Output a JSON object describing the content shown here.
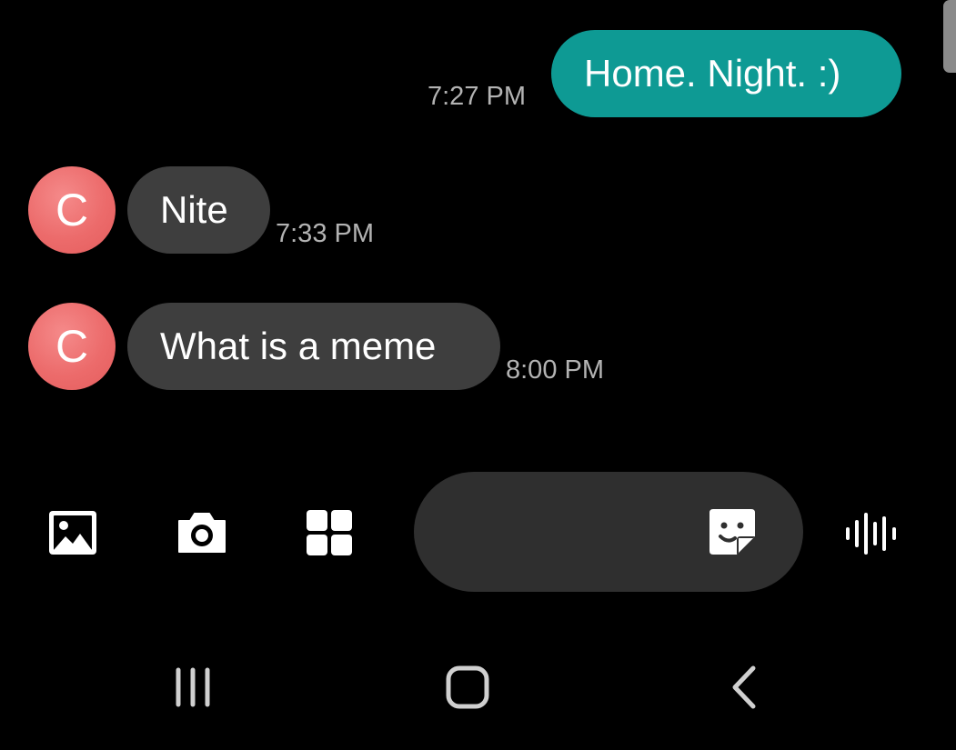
{
  "conversation": {
    "messages": [
      {
        "direction": "sent",
        "text": "Home. Night. :)",
        "time": "7:27 PM"
      },
      {
        "direction": "received",
        "avatar_initial": "C",
        "text": "Nite",
        "time": "7:33 PM"
      },
      {
        "direction": "received",
        "avatar_initial": "C",
        "text": "What is a meme",
        "time": "8:00 PM"
      }
    ]
  },
  "composer": {
    "icons": [
      "gallery-icon",
      "camera-icon",
      "apps-grid-icon",
      "sticker-icon",
      "voice-record-icon"
    ],
    "input_value": ""
  },
  "navbar": {
    "icons": [
      "recent-apps-icon",
      "home-icon",
      "back-icon"
    ]
  },
  "colors": {
    "background": "#000000",
    "sent_bubble": "#0e9a94",
    "received_bubble": "#3e3e3e",
    "avatar": "#ec6b6b",
    "timestamp": "#b3b3b3"
  }
}
